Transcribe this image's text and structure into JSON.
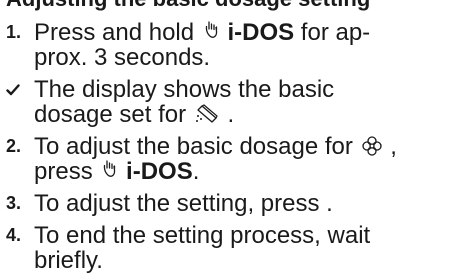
{
  "heading_fragment": "Adjusting the basic dosage setting",
  "steps": [
    {
      "marker": "1.",
      "before": "Press and hold",
      "icon": "i-dos-hand-icon",
      "button_label": "i-DOS",
      "after": "for ap-",
      "line2": "prox. 3 seconds."
    },
    {
      "marker": "check-icon",
      "before": "The display shows the basic",
      "line2_before": "dosage set for",
      "icon": "detergent-bottle-icon",
      "line2_after": "."
    },
    {
      "marker": "2.",
      "before": "To adjust the basic dosage for",
      "icon": "softener-flower-icon",
      "after": ",",
      "line2_before": "press",
      "icon2": "i-dos-hand-icon",
      "button_label": "i-DOS",
      "line2_after": "."
    },
    {
      "marker": "3.",
      "text": "To adjust the setting, press ."
    },
    {
      "marker": "4.",
      "before": "To end the setting process, wait",
      "line2": "briefly."
    }
  ]
}
